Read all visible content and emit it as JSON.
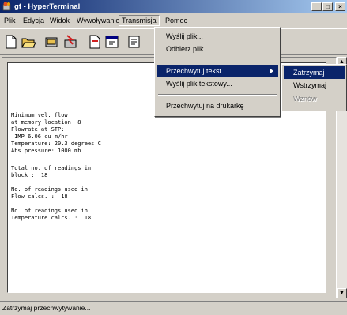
{
  "window": {
    "title": "gf - HyperTerminal",
    "min_symbol": "_",
    "max_symbol": "□",
    "close_symbol": "×"
  },
  "menubar": {
    "items": [
      {
        "label": "Plik"
      },
      {
        "label": "Edycja"
      },
      {
        "label": "Widok"
      },
      {
        "label": "Wywoływanie"
      },
      {
        "label": "Transmisja"
      },
      {
        "label": "Pomoc"
      }
    ]
  },
  "toolbar": {
    "icons": [
      "new-icon",
      "open-icon",
      "connect-icon",
      "disconnect-icon",
      "send-icon",
      "receive-icon",
      "properties-icon"
    ]
  },
  "transmisja_menu": {
    "items": [
      {
        "label": "Wyślij plik..."
      },
      {
        "label": "Odbierz plik..."
      },
      {
        "label": "Przechwytuj tekst"
      },
      {
        "label": "Wyślij plik tekstowy..."
      },
      {
        "label": "Przechwytuj na drukarkę"
      }
    ]
  },
  "submenu": {
    "items": [
      {
        "label": "Zatrzymaj"
      },
      {
        "label": "Wstrzymaj"
      },
      {
        "label": "Wznów"
      }
    ]
  },
  "terminal": {
    "lines": [
      "Minimum vel. flow",
      "at memory location  8",
      "Flowrate at STP:",
      " IMP 6.06 cu m/hr",
      "Temperature: 20.3 degrees C",
      "Abs pressure: 1000 mb",
      "",
      "",
      "Total no. of readings in",
      "block :  18",
      "",
      "No. of readings used in",
      "Flow calcs. :  18",
      "",
      "No. of readings used in",
      "Temperature calcs. :  18"
    ]
  },
  "statusbar": {
    "text": "Zatrzymaj przechwytywanie..."
  },
  "colors": {
    "title_start": "#0a246a",
    "title_end": "#a6caf0",
    "highlight": "#0a246a",
    "face": "#d4d0c8"
  }
}
